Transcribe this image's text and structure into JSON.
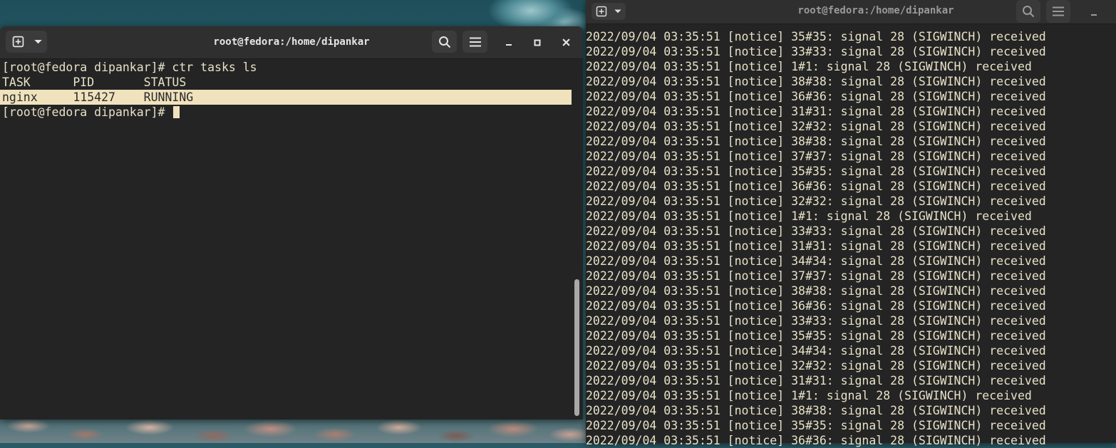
{
  "left_window": {
    "title": "root@fedora:/home/dipankar",
    "lines": [
      "[root@fedora dipankar]# ctr tasks ls",
      "TASK      PID       STATUS",
      "nginx     115427    RUNNING",
      "[root@fedora dipankar]# "
    ],
    "highlighted_line_index": 2
  },
  "right_window": {
    "title": "root@fedora:/home/dipankar",
    "lines": [
      "2022/09/04 03:35:51 [notice] 35#35: signal 28 (SIGWINCH) received",
      "2022/09/04 03:35:51 [notice] 33#33: signal 28 (SIGWINCH) received",
      "2022/09/04 03:35:51 [notice] 1#1: signal 28 (SIGWINCH) received",
      "2022/09/04 03:35:51 [notice] 38#38: signal 28 (SIGWINCH) received",
      "2022/09/04 03:35:51 [notice] 36#36: signal 28 (SIGWINCH) received",
      "2022/09/04 03:35:51 [notice] 31#31: signal 28 (SIGWINCH) received",
      "2022/09/04 03:35:51 [notice] 32#32: signal 28 (SIGWINCH) received",
      "2022/09/04 03:35:51 [notice] 38#38: signal 28 (SIGWINCH) received",
      "2022/09/04 03:35:51 [notice] 37#37: signal 28 (SIGWINCH) received",
      "2022/09/04 03:35:51 [notice] 35#35: signal 28 (SIGWINCH) received",
      "2022/09/04 03:35:51 [notice] 36#36: signal 28 (SIGWINCH) received",
      "2022/09/04 03:35:51 [notice] 32#32: signal 28 (SIGWINCH) received",
      "2022/09/04 03:35:51 [notice] 1#1: signal 28 (SIGWINCH) received",
      "2022/09/04 03:35:51 [notice] 33#33: signal 28 (SIGWINCH) received",
      "2022/09/04 03:35:51 [notice] 31#31: signal 28 (SIGWINCH) received",
      "2022/09/04 03:35:51 [notice] 34#34: signal 28 (SIGWINCH) received",
      "2022/09/04 03:35:51 [notice] 37#37: signal 28 (SIGWINCH) received",
      "2022/09/04 03:35:51 [notice] 38#38: signal 28 (SIGWINCH) received",
      "2022/09/04 03:35:51 [notice] 36#36: signal 28 (SIGWINCH) received",
      "2022/09/04 03:35:51 [notice] 33#33: signal 28 (SIGWINCH) received",
      "2022/09/04 03:35:51 [notice] 35#35: signal 28 (SIGWINCH) received",
      "2022/09/04 03:35:51 [notice] 34#34: signal 28 (SIGWINCH) received",
      "2022/09/04 03:35:51 [notice] 32#32: signal 28 (SIGWINCH) received",
      "2022/09/04 03:35:51 [notice] 31#31: signal 28 (SIGWINCH) received",
      "2022/09/04 03:35:51 [notice] 1#1: signal 28 (SIGWINCH) received",
      "2022/09/04 03:35:51 [notice] 38#38: signal 28 (SIGWINCH) received",
      "2022/09/04 03:35:51 [notice] 35#35: signal 28 (SIGWINCH) received",
      "2022/09/04 03:35:51 [notice] 36#36: signal 28 (SIGWINCH) received"
    ]
  },
  "icons": {
    "new_tab": "new-tab-icon",
    "dropdown": "chevron-down-icon",
    "search": "search-icon",
    "menu": "hamburger-menu-icon",
    "minimize": "minimize-icon",
    "maximize": "maximize-icon",
    "close": "close-icon"
  },
  "colors": {
    "terminal_bg": "#242424",
    "terminal_fg": "#e8e2c8",
    "highlight_bg": "#efe2bd",
    "headerbar_bg": "#2f2f2f"
  }
}
